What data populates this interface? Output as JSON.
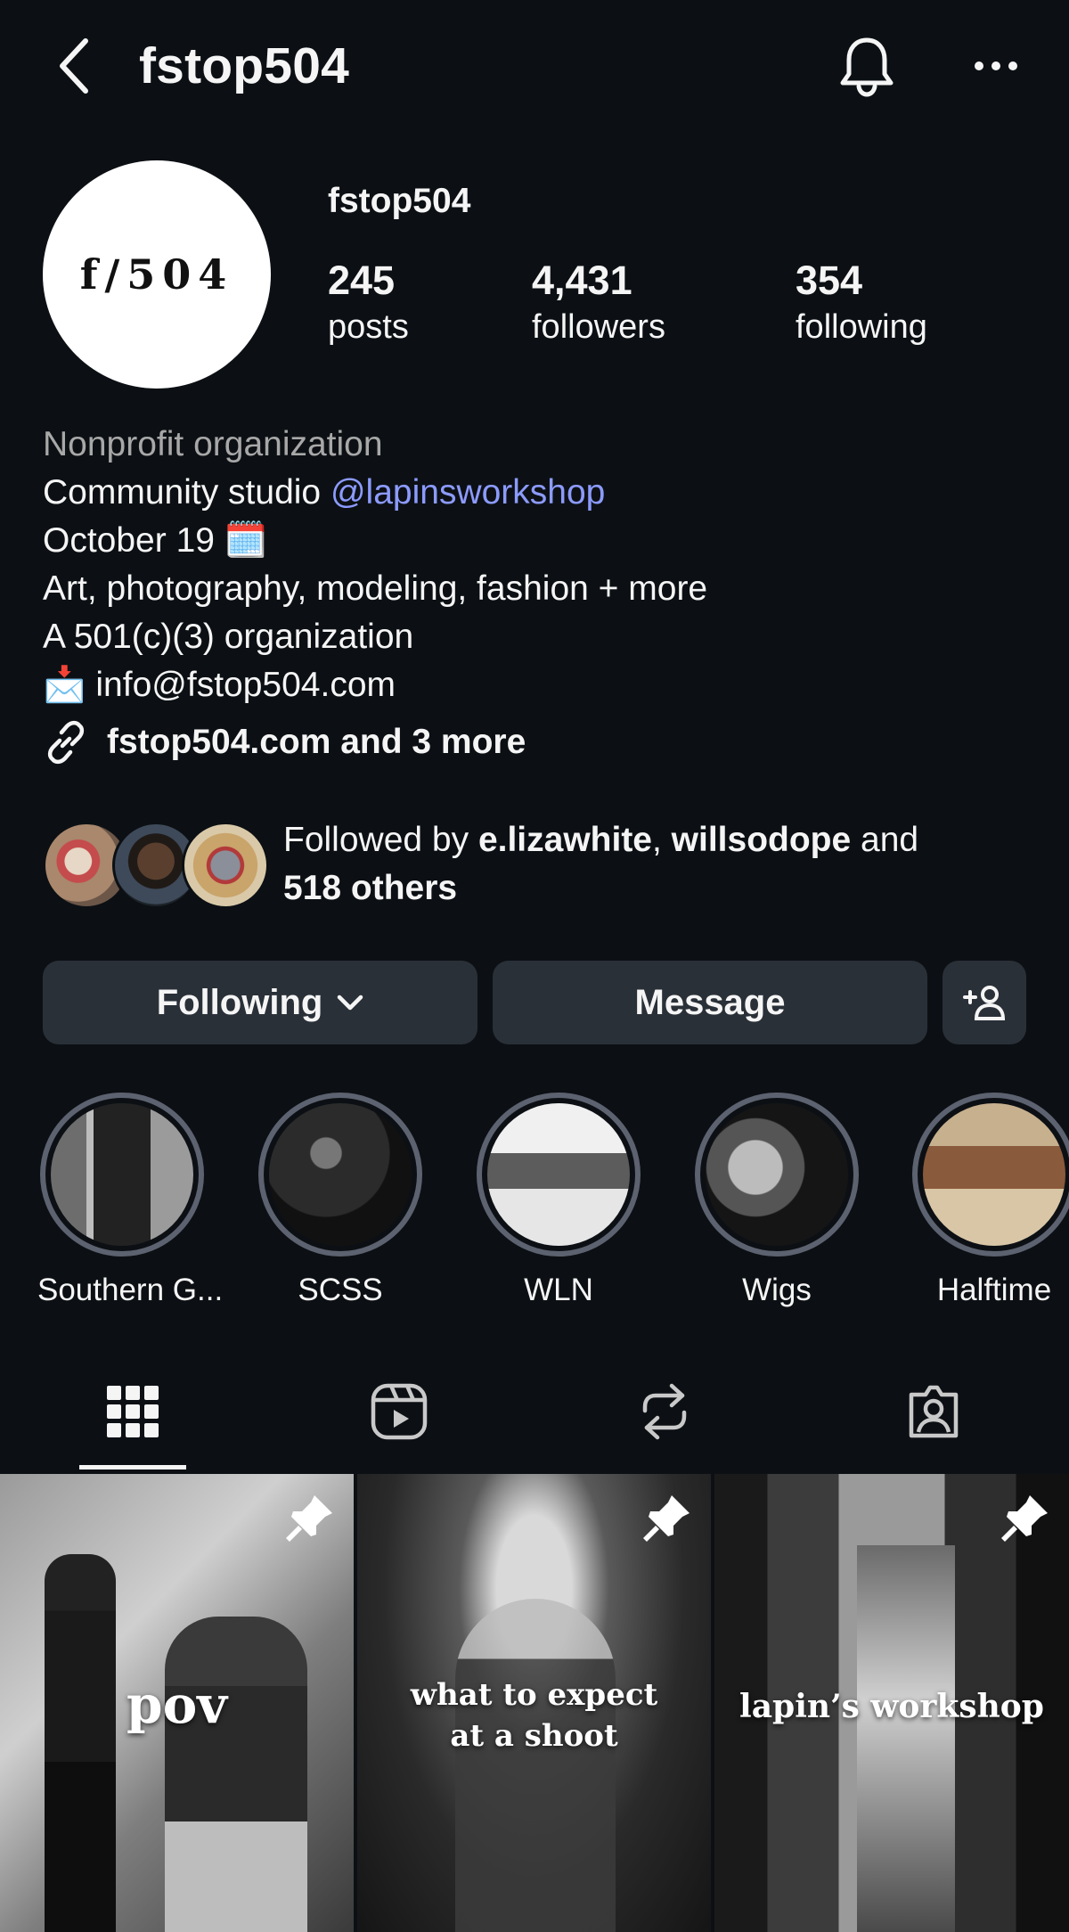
{
  "header": {
    "title": "fstop504"
  },
  "profile": {
    "avatar_text": "f/504",
    "username": "fstop504",
    "stats": [
      {
        "value": "245",
        "label": "posts"
      },
      {
        "value": "4,431",
        "label": "followers"
      },
      {
        "value": "354",
        "label": "following"
      }
    ]
  },
  "bio": {
    "category": "Nonprofit organization",
    "line1_prefix": "Community studio ",
    "line1_mention": "@lapinsworkshop",
    "line2": "October 19 🗓️",
    "line3": "Art, photography, modeling, fashion + more",
    "line4": "A 501(c)(3) organization",
    "line5": "📩 info@fstop504.com",
    "link": "fstop504.com and 3 more"
  },
  "followed_by": {
    "prefix": "Followed by ",
    "user1": "e.lizawhite",
    "sep": ", ",
    "user2": "willsodope",
    "and": " and",
    "others": "518 others"
  },
  "actions": {
    "following": "Following",
    "message": "Message"
  },
  "highlights": [
    {
      "label": "Southern G..."
    },
    {
      "label": "SCSS"
    },
    {
      "label": "WLN"
    },
    {
      "label": "Wigs"
    },
    {
      "label": "Halftime"
    }
  ],
  "posts": [
    {
      "caption": "pov"
    },
    {
      "caption_line1": "what to expect",
      "caption_line2": "at a shoot"
    },
    {
      "caption": "lapin’s workshop"
    }
  ],
  "colors": {
    "background": "#0c1014",
    "button": "#2a3038",
    "mention": "#8c9bff",
    "category": "#a8a8a8"
  }
}
